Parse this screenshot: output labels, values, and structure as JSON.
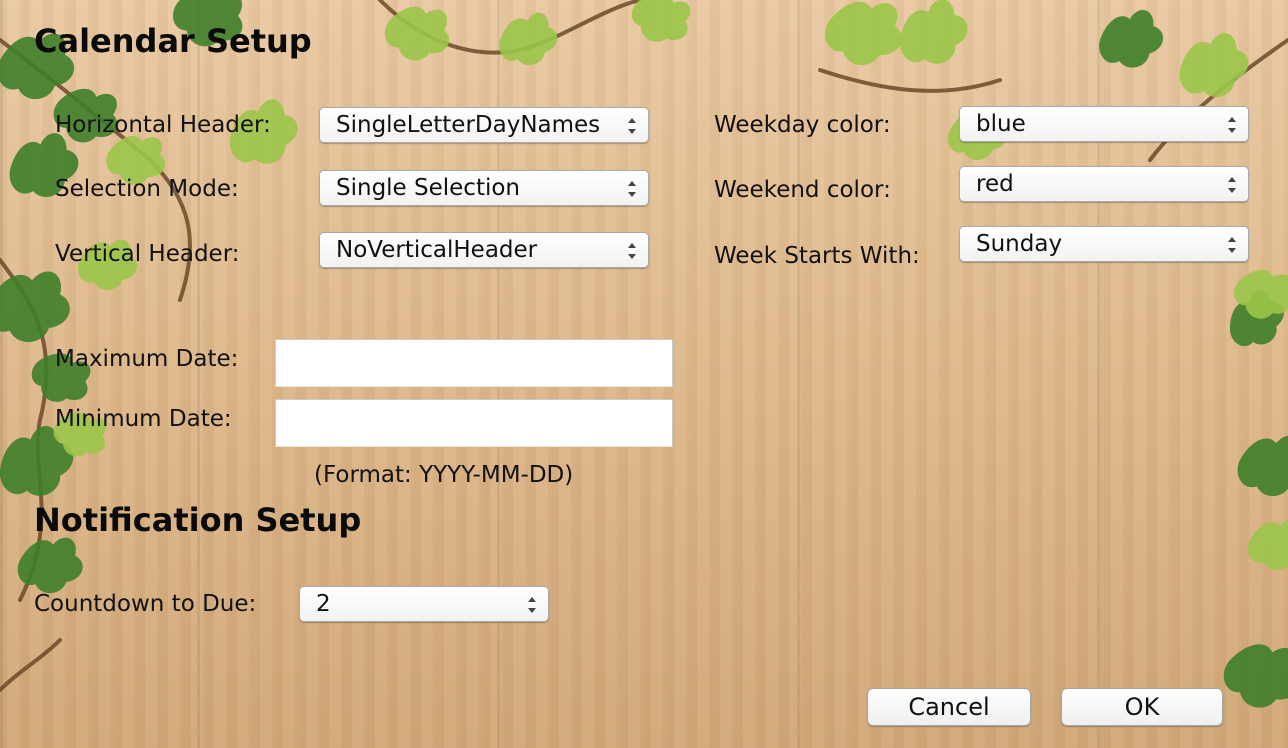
{
  "calendar_setup": {
    "title": "Calendar Setup",
    "horizontal_header": {
      "label": "Horizontal Header:",
      "value": "SingleLetterDayNames"
    },
    "selection_mode": {
      "label": "Selection Mode:",
      "value": "Single Selection"
    },
    "vertical_header": {
      "label": "Vertical Header:",
      "value": "NoVerticalHeader"
    },
    "weekday_color": {
      "label": "Weekday color:",
      "value": "blue"
    },
    "weekend_color": {
      "label": "Weekend color:",
      "value": "red"
    },
    "week_starts_with": {
      "label": "Week Starts With:",
      "value": "Sunday"
    },
    "maximum_date": {
      "label": "Maximum Date:",
      "value": ""
    },
    "minimum_date": {
      "label": "Minimum Date:",
      "value": ""
    },
    "format_hint": "(Format: YYYY-MM-DD)"
  },
  "notification_setup": {
    "title": "Notification Setup",
    "countdown": {
      "label": "Countdown to Due:",
      "value": "2"
    }
  },
  "buttons": {
    "cancel": "Cancel",
    "ok": "OK"
  },
  "icons": {
    "select_arrows": "up-down-chevron-icon"
  },
  "colors": {
    "leaf_dark": "#3e7f2a",
    "leaf_light": "#9bc64a",
    "wood": "#dcb688"
  }
}
